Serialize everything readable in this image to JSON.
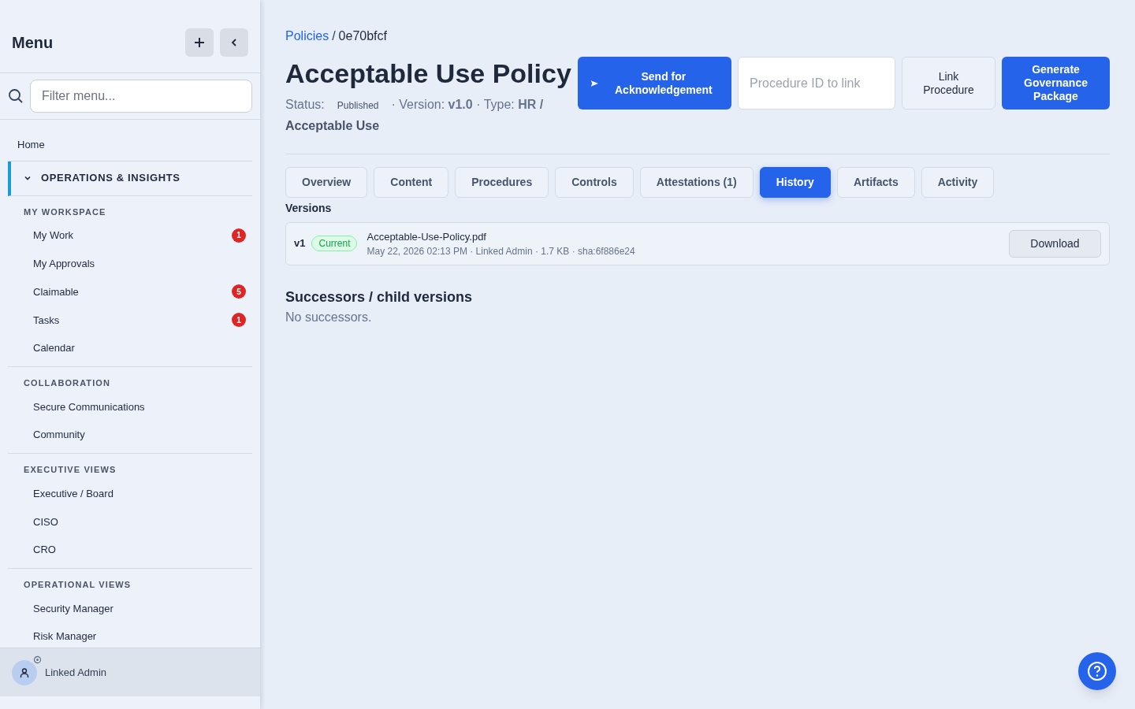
{
  "sidebar": {
    "title": "Menu",
    "filter": {
      "placeholder": "Filter menu..."
    },
    "home": "Home",
    "group": {
      "label": "OPERATIONS & INSIGHTS",
      "expanded": true
    },
    "sections": [
      {
        "title": "MY WORKSPACE",
        "items": [
          {
            "label": "My Work",
            "badge": "1"
          },
          {
            "label": "My Approvals"
          },
          {
            "label": "Claimable",
            "badge": "5"
          },
          {
            "label": "Tasks",
            "badge": "1"
          },
          {
            "label": "Calendar"
          }
        ]
      },
      {
        "title": "COLLABORATION",
        "items": [
          {
            "label": "Secure Communications"
          },
          {
            "label": "Community"
          }
        ]
      },
      {
        "title": "EXECUTIVE VIEWS",
        "items": [
          {
            "label": "Executive / Board"
          },
          {
            "label": "CISO"
          },
          {
            "label": "CRO"
          }
        ]
      },
      {
        "title": "OPERATIONAL VIEWS",
        "items": [
          {
            "label": "Security Manager"
          },
          {
            "label": "Risk Manager"
          }
        ]
      }
    ],
    "user": "Linked Admin"
  },
  "breadcrumb": {
    "link": "Policies",
    "separator": "/",
    "current": "0e70bfcf"
  },
  "title": "Acceptable Use Policy",
  "status": {
    "label": "Status:",
    "value": "Published"
  },
  "details": "· Version: **v1.0** · Type: **HR /**",
  "details_continued": "Acceptable Use",
  "actions": {
    "send": "Send for Acknowledgement",
    "procedure_field": {
      "placeholder": "Procedure ID to link"
    },
    "link": "Link Procedure",
    "generate": "Generate Governance Package"
  },
  "tabs": [
    {
      "label": "Overview",
      "selected": false
    },
    {
      "label": "Content",
      "selected": false
    },
    {
      "label": "Procedures",
      "selected": false
    },
    {
      "label": "Controls",
      "selected": false
    },
    {
      "label": "Attestations (1)",
      "selected": false
    },
    {
      "label": "History",
      "selected": true
    },
    {
      "label": "Artifacts",
      "selected": false
    },
    {
      "label": "Activity",
      "selected": false
    }
  ],
  "versions": {
    "heading": "Versions",
    "items": [
      {
        "version": "v1",
        "tag": "Current",
        "file": "Acceptable-Use-Policy.pdf",
        "meta": "May 22, 2026 02:13 PM · Linked Admin · 1.7 KB · sha:6f886e24",
        "action": "Download"
      }
    ]
  },
  "successors": {
    "heading": "Successors / child versions",
    "empty": "No successors."
  }
}
